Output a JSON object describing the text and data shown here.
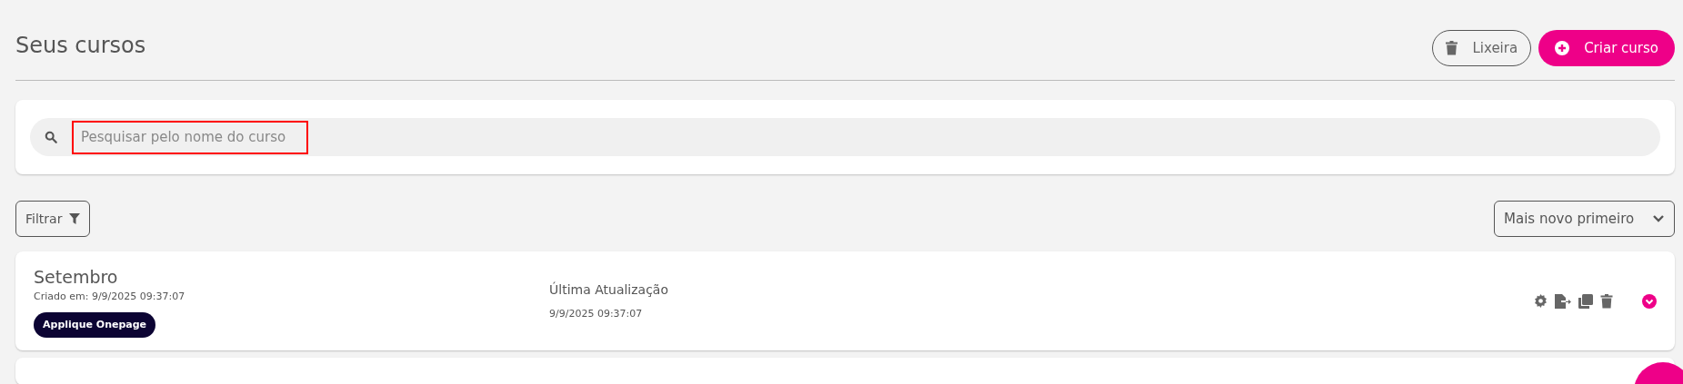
{
  "header": {
    "title": "Seus cursos",
    "buttons": [
      {
        "kind": "outline",
        "label": "Lixeira"
      },
      {
        "kind": "primary",
        "label": "Criar curso"
      }
    ]
  },
  "search": {
    "placeholder": "Pesquisar pelo nome do curso",
    "highlighted": true
  },
  "toolbar": {
    "filter_label": "Filtrar",
    "sort": "Mais novo primeiro"
  },
  "courses": [
    {
      "name": "Setembro",
      "created": "Criado em: 9/9/2025 09:37:07",
      "tag": "Applique Onepage",
      "updated_label": "Última Atualização",
      "updated": "9/9/2025 09:37:07"
    }
  ]
}
